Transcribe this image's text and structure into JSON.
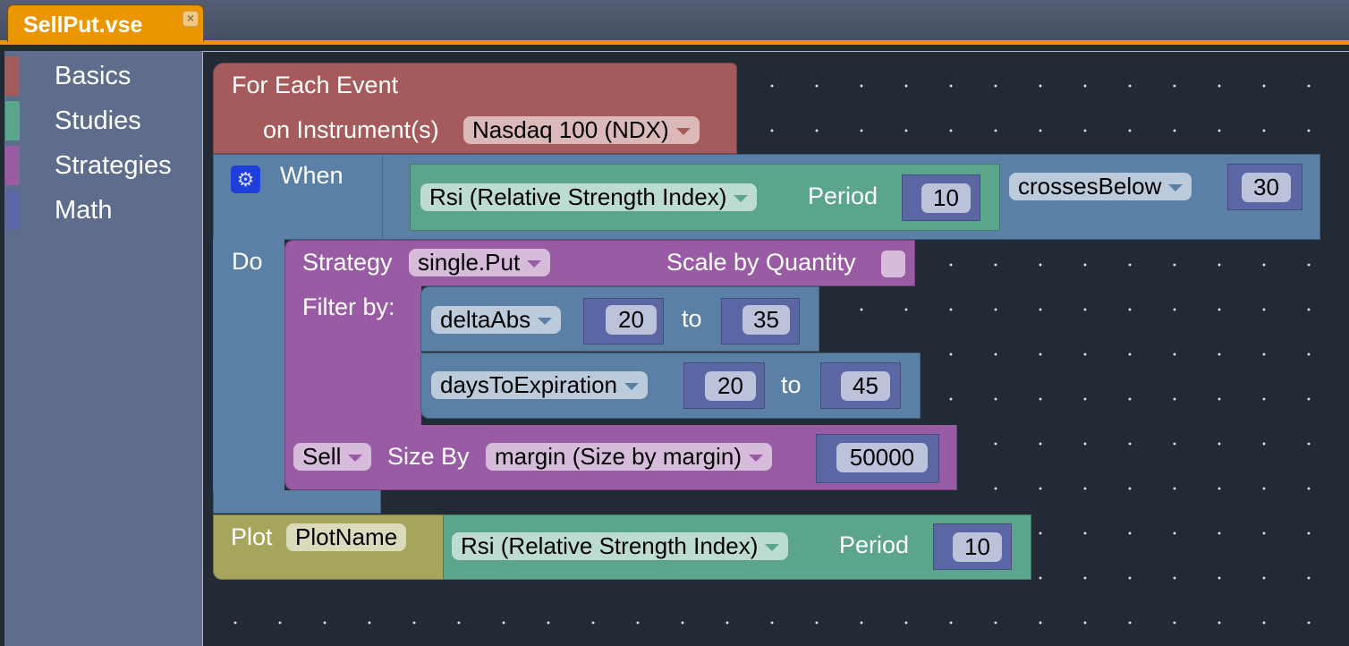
{
  "tab": {
    "title": "SellPut.vse",
    "close_icon": "close-icon"
  },
  "sidebar": {
    "categories": [
      {
        "label": "Basics",
        "color": "#a55b5b"
      },
      {
        "label": "Studies",
        "color": "#5ba58c"
      },
      {
        "label": "Strategies",
        "color": "#9a5ba5"
      },
      {
        "label": "Math",
        "color": "#5b67a5"
      }
    ]
  },
  "blocks": {
    "for_each": {
      "title": "For Each Event",
      "instrument_label": "on Instrument(s)",
      "instrument": "Nasdaq 100 (NDX)"
    },
    "when": {
      "label": "When",
      "do_label": "Do",
      "study": "Rsi (Relative Strength Index)",
      "period_label": "Period",
      "period": "10",
      "operator": "crossesBelow",
      "threshold": "30"
    },
    "strategy": {
      "label": "Strategy",
      "value": "single.Put",
      "scale_label": "Scale by Quantity",
      "scale_checked": false,
      "filter_label": "Filter by:",
      "filters": [
        {
          "field": "deltaAbs",
          "from": "20",
          "to_label": "to",
          "to": "35"
        },
        {
          "field": "daysToExpiration",
          "from": "20",
          "to_label": "to",
          "to": "45"
        }
      ],
      "action": "Sell",
      "size_label": "Size By",
      "size_method": "margin (Size by margin)",
      "size_value": "50000"
    },
    "plot": {
      "label": "Plot",
      "name": "PlotName",
      "study": "Rsi (Relative Strength Index)",
      "period_label": "Period",
      "period": "10"
    }
  }
}
